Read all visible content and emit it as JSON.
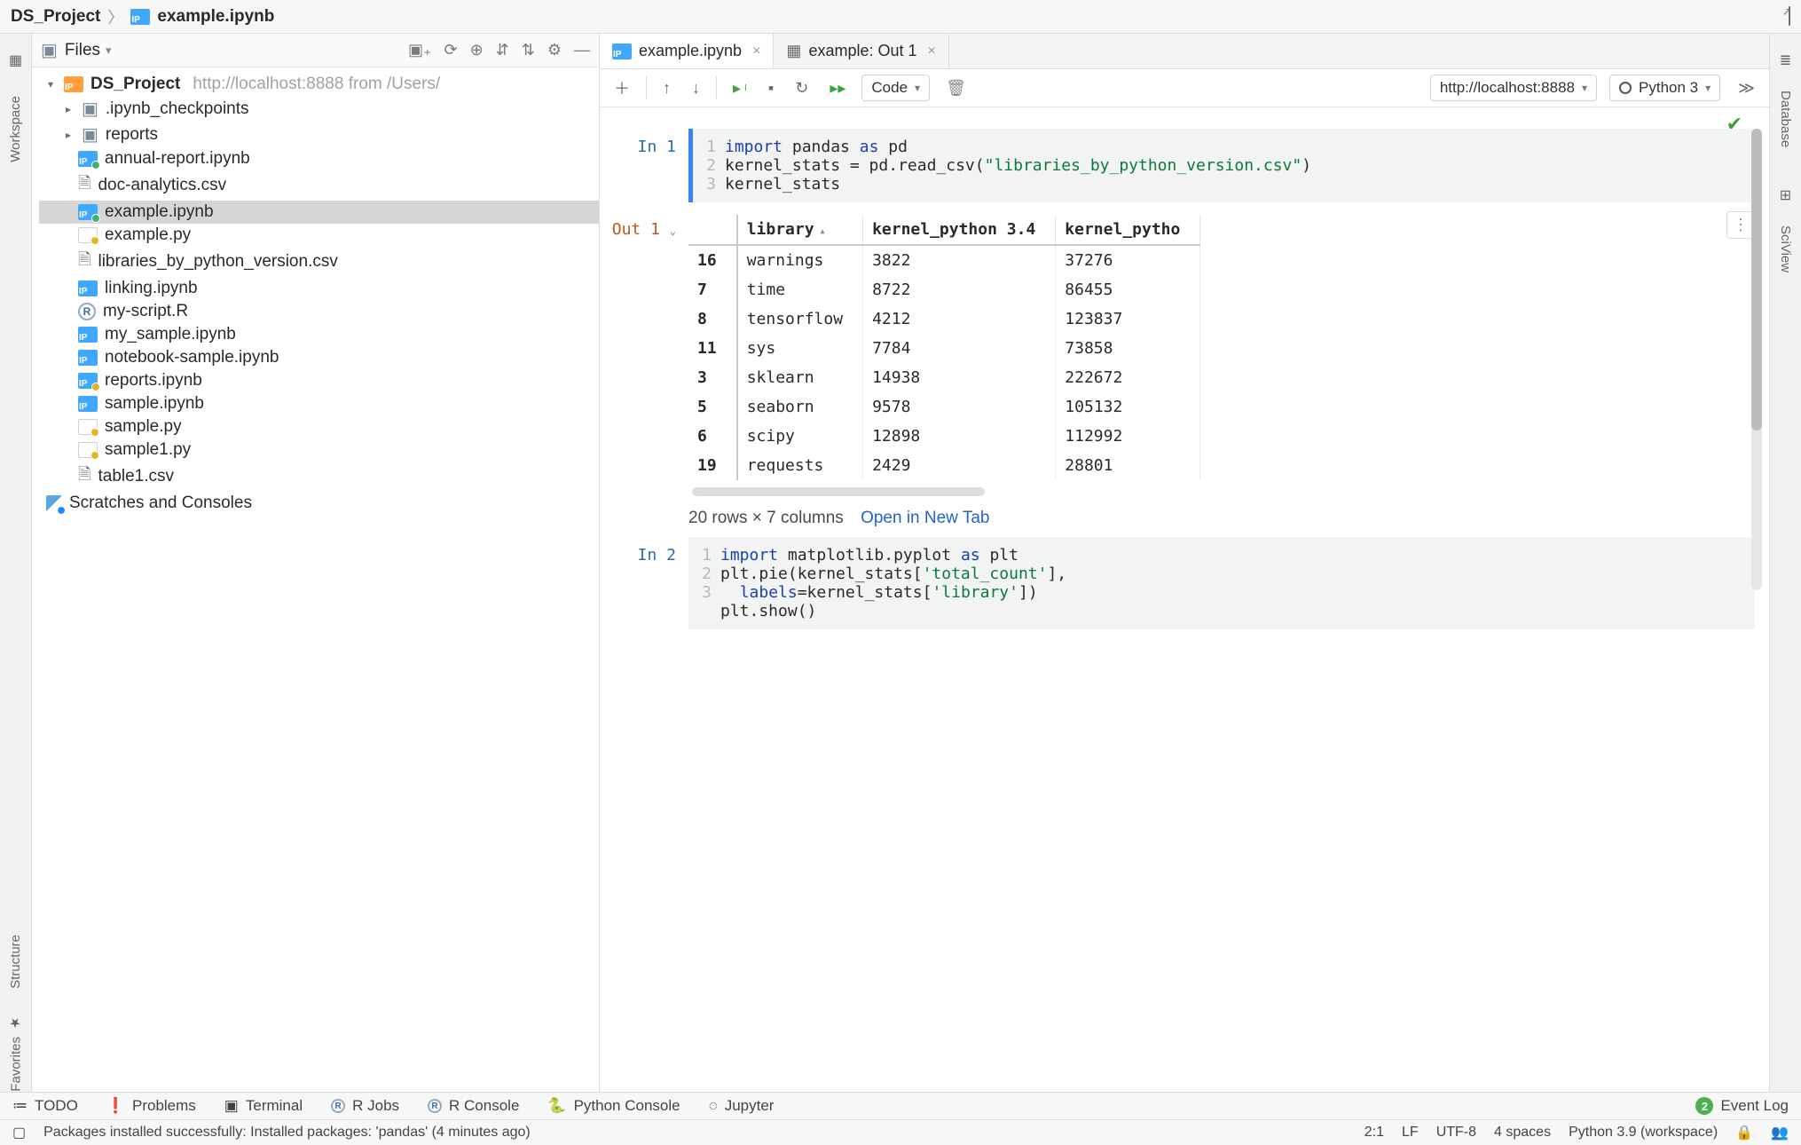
{
  "breadcrumb": {
    "project": "DS_Project",
    "file": "example.ipynb"
  },
  "project_panel": {
    "selector_label": "Files",
    "root_name": "DS_Project",
    "root_path": "http://localhost:8888 from /Users/",
    "folders": [
      {
        "name": ".ipynb_checkpoints"
      },
      {
        "name": "reports"
      }
    ],
    "files": [
      {
        "name": "annual-report.ipynb",
        "icon": "ipynb-green"
      },
      {
        "name": "doc-analytics.csv",
        "icon": "csv"
      },
      {
        "name": "example.ipynb",
        "icon": "ipynb-green",
        "selected": true
      },
      {
        "name": "example.py",
        "icon": "py"
      },
      {
        "name": "libraries_by_python_version.csv",
        "icon": "csv"
      },
      {
        "name": "linking.ipynb",
        "icon": "ipynb"
      },
      {
        "name": "my-script.R",
        "icon": "r"
      },
      {
        "name": "my_sample.ipynb",
        "icon": "ipynb"
      },
      {
        "name": "notebook-sample.ipynb",
        "icon": "ipynb"
      },
      {
        "name": "reports.ipynb",
        "icon": "ipynb-yellow"
      },
      {
        "name": "sample.ipynb",
        "icon": "ipynb"
      },
      {
        "name": "sample.py",
        "icon": "py"
      },
      {
        "name": "sample1.py",
        "icon": "py"
      },
      {
        "name": "table1.csv",
        "icon": "csv"
      }
    ],
    "scratches_label": "Scratches and Consoles"
  },
  "tabs": [
    {
      "label": "example.ipynb",
      "icon": "ipynb",
      "active": true
    },
    {
      "label": "example: Out 1",
      "icon": "table",
      "active": false
    }
  ],
  "nb_toolbar": {
    "celltype": "Code",
    "server": "http://localhost:8888",
    "kernel": "Python 3"
  },
  "cell1": {
    "prompt": "In 1",
    "lines": [
      "1",
      "2",
      "3"
    ]
  },
  "out1": {
    "prompt": "Out 1",
    "columns": [
      "",
      "library",
      "kernel_python 3.4",
      "kernel_pytho"
    ],
    "rows": [
      [
        "16",
        "warnings",
        "3822",
        "37276"
      ],
      [
        "7",
        "time",
        "8722",
        "86455"
      ],
      [
        "8",
        "tensorflow",
        "4212",
        "123837"
      ],
      [
        "11",
        "sys",
        "7784",
        "73858"
      ],
      [
        "3",
        "sklearn",
        "14938",
        "222672"
      ],
      [
        "5",
        "seaborn",
        "9578",
        "105132"
      ],
      [
        "6",
        "scipy",
        "12898",
        "112992"
      ],
      [
        "19",
        "requests",
        "2429",
        "28801"
      ]
    ],
    "meta": "20 rows × 7 columns",
    "open_link": "Open in New Tab"
  },
  "cell2": {
    "prompt": "In 2",
    "lines": [
      "1",
      "2",
      "",
      "3"
    ]
  },
  "left_rail": {
    "workspace": "Workspace",
    "structure": "Structure",
    "favorites": "Favorites"
  },
  "right_rail": {
    "database": "Database",
    "sciview": "SciView"
  },
  "tool_row": {
    "todo": "TODO",
    "problems": "Problems",
    "terminal": "Terminal",
    "rjobs": "R Jobs",
    "rconsole": "R Console",
    "pyconsole": "Python Console",
    "jupyter": "Jupyter",
    "event_badge": "2",
    "event_log": "Event Log"
  },
  "status": {
    "msg": "Packages installed successfully: Installed packages: 'pandas' (4 minutes ago)",
    "pos": "2:1",
    "lf": "LF",
    "enc": "UTF-8",
    "indent": "4 spaces",
    "interp": "Python 3.9 (workspace)"
  }
}
